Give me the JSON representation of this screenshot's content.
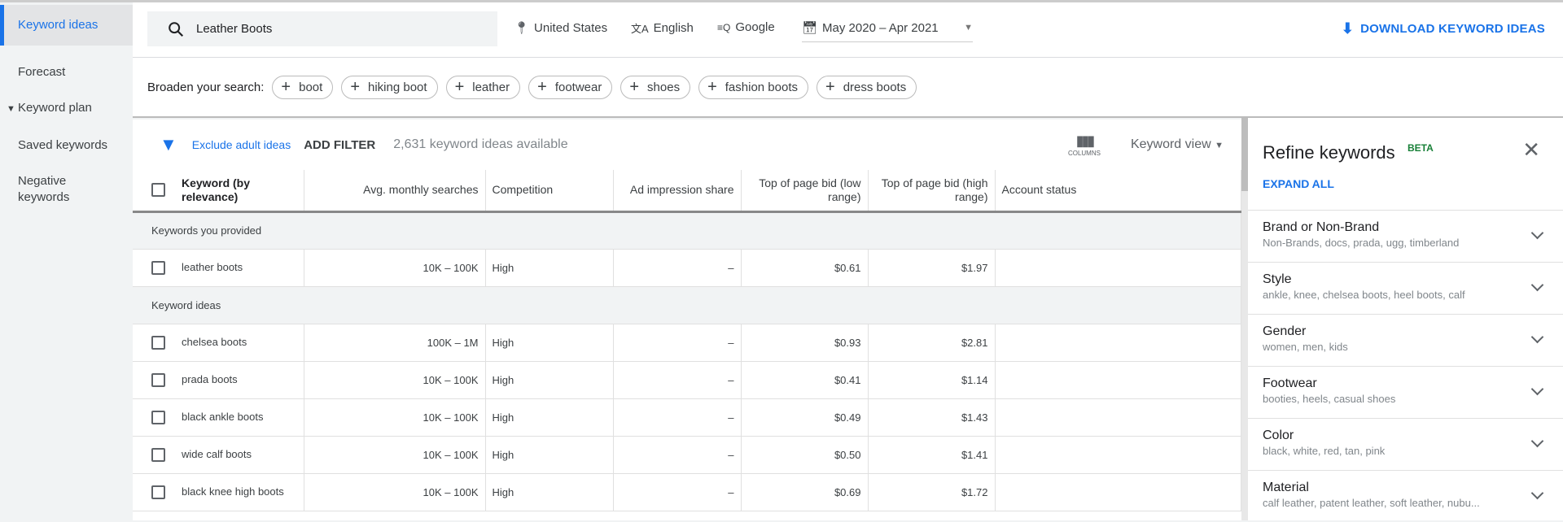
{
  "sidebar": {
    "items": [
      {
        "label": "Keyword ideas"
      },
      {
        "label": "Forecast"
      },
      {
        "label": "Keyword plan"
      },
      {
        "label": "Saved keywords"
      },
      {
        "label": "Negative keywords"
      }
    ]
  },
  "topbar": {
    "search_value": "Leather Boots",
    "location": "United States",
    "language": "English",
    "network": "Google",
    "date_range": "May 2020 – Apr 2021",
    "download_label": "DOWNLOAD KEYWORD IDEAS"
  },
  "broaden": {
    "label": "Broaden your search:",
    "chips": [
      "boot",
      "hiking boot",
      "leather",
      "footwear",
      "shoes",
      "fashion boots",
      "dress boots"
    ]
  },
  "filterbar": {
    "exclude_label": "Exclude adult ideas",
    "add_filter": "ADD FILTER",
    "count_text": "2,631 keyword ideas available",
    "columns_label": "COLUMNS",
    "view_label": "Keyword view"
  },
  "table": {
    "headers": [
      "Keyword (by relevance)",
      "Avg. monthly searches",
      "Competition",
      "Ad impression share",
      "Top of page bid (low range)",
      "Top of page bid (high range)",
      "Account status"
    ],
    "group_provided": "Keywords you provided",
    "provided": [
      [
        "leather boots",
        "10K – 100K",
        "High",
        "–",
        "$0.61",
        "$1.97",
        ""
      ]
    ],
    "group_ideas": "Keyword ideas",
    "ideas": [
      [
        "chelsea boots",
        "100K – 1M",
        "High",
        "–",
        "$0.93",
        "$2.81",
        ""
      ],
      [
        "prada boots",
        "10K – 100K",
        "High",
        "–",
        "$0.41",
        "$1.14",
        ""
      ],
      [
        "black ankle boots",
        "10K – 100K",
        "High",
        "–",
        "$0.49",
        "$1.43",
        ""
      ],
      [
        "wide calf boots",
        "10K – 100K",
        "High",
        "–",
        "$0.50",
        "$1.41",
        ""
      ],
      [
        "black knee high boots",
        "10K – 100K",
        "High",
        "–",
        "$0.69",
        "$1.72",
        ""
      ]
    ]
  },
  "refine": {
    "title": "Refine keywords",
    "badge": "BETA",
    "expand_all": "EXPAND ALL",
    "items": [
      {
        "title": "Brand or Non-Brand",
        "sub": "Non-Brands, docs, prada, ugg, timberland"
      },
      {
        "title": "Style",
        "sub": "ankle, knee, chelsea boots, heel boots, calf"
      },
      {
        "title": "Gender",
        "sub": "women, men, kids"
      },
      {
        "title": "Footwear",
        "sub": "booties, heels, casual shoes"
      },
      {
        "title": "Color",
        "sub": "black, white, red, tan, pink"
      },
      {
        "title": "Material",
        "sub": "calf leather, patent leather, soft leather, nubu..."
      }
    ]
  },
  "colors": {
    "accent": "#1a73e8",
    "beta": "#188038"
  }
}
